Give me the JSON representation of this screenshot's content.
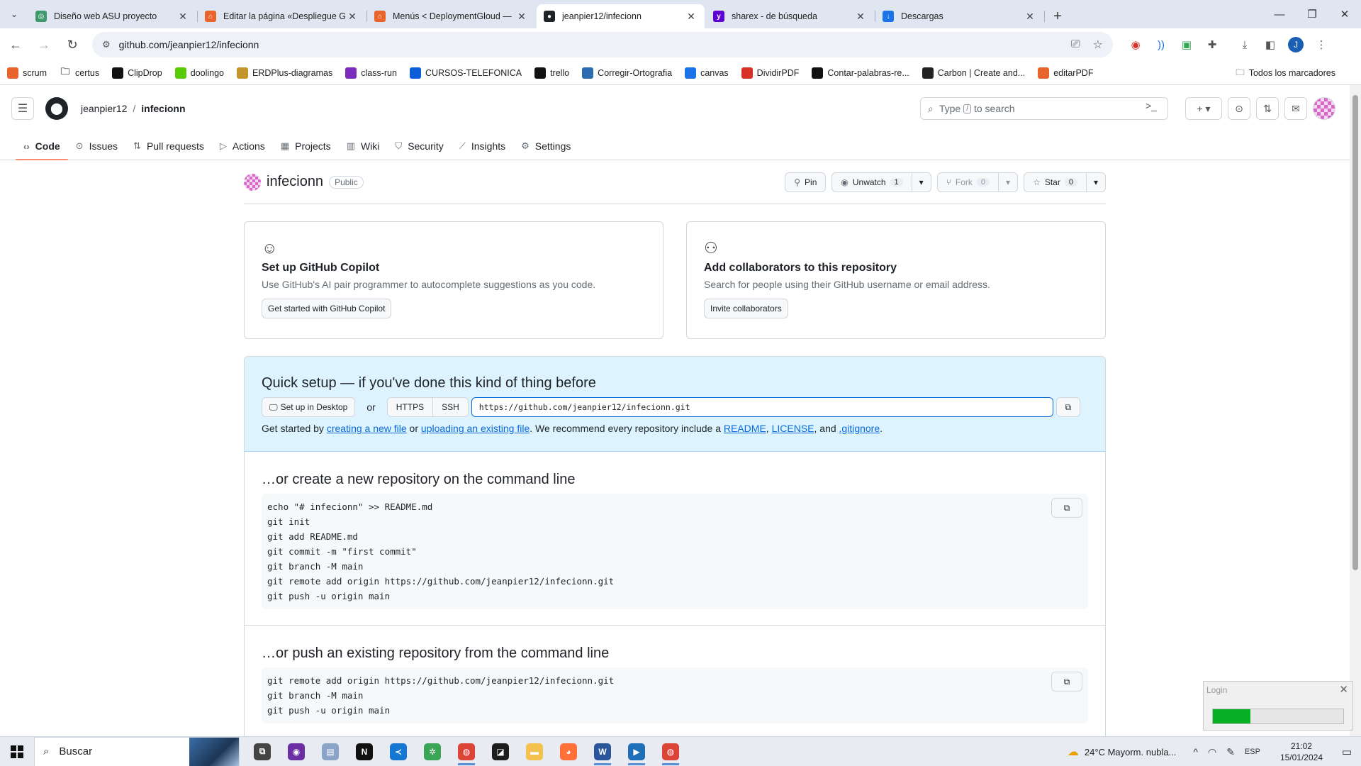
{
  "browser": {
    "tabs": [
      {
        "title": "Diseño web ASU proyecto",
        "color": "#3f9a6b",
        "glyph": "◎"
      },
      {
        "title": "Editar la página «Despliegue Gi",
        "color": "#e8642c",
        "glyph": "⌂"
      },
      {
        "title": "Menús < DeploymentGloud —",
        "color": "#e8642c",
        "glyph": "⌂"
      },
      {
        "title": "jeanpier12/infecionn",
        "color": "#1f2328",
        "glyph": "●",
        "active": true
      },
      {
        "title": "sharex - de búsqueda",
        "color": "#5f01d1",
        "glyph": "y"
      },
      {
        "title": "Descargas",
        "color": "#1a73e8",
        "glyph": "↓"
      }
    ],
    "url": "github.com/jeanpier12/infecionn",
    "profile_initial": "J",
    "bookmarks": [
      {
        "label": "scrum",
        "color": "#e8642c"
      },
      {
        "label": "certus",
        "color": "#555555",
        "folder": true
      },
      {
        "label": "ClipDrop",
        "color": "#111111"
      },
      {
        "label": "doolingo",
        "color": "#58cc02"
      },
      {
        "label": "ERDPlus-diagramas",
        "color": "#c4952c"
      },
      {
        "label": "class-run",
        "color": "#7b2cbf"
      },
      {
        "label": "CURSOS-TELEFONICA",
        "color": "#0b5ed7"
      },
      {
        "label": "trello",
        "color": "#111111"
      },
      {
        "label": "Corregir-Ortografia",
        "color": "#2b6cb0"
      },
      {
        "label": "canvas",
        "color": "#1a73e8"
      },
      {
        "label": "DividirPDF",
        "color": "#d93025"
      },
      {
        "label": "Contar-palabras-re...",
        "color": "#111111"
      },
      {
        "label": "Carbon | Create and...",
        "color": "#222222"
      },
      {
        "label": "editarPDF",
        "color": "#e8642c"
      }
    ],
    "all_bookmarks": "Todos los marcadores"
  },
  "github": {
    "owner": "jeanpier12",
    "repo": "infecionn",
    "search_prefix": "Type",
    "search_key": "/",
    "search_suffix": "to search",
    "nav": [
      {
        "label": "Code",
        "icon": "‹›",
        "active": true
      },
      {
        "label": "Issues",
        "icon": "⊙"
      },
      {
        "label": "Pull requests",
        "icon": "⇅"
      },
      {
        "label": "Actions",
        "icon": "▷"
      },
      {
        "label": "Projects",
        "icon": "▦"
      },
      {
        "label": "Wiki",
        "icon": "▥"
      },
      {
        "label": "Security",
        "icon": "⛉"
      },
      {
        "label": "Insights",
        "icon": "⟋"
      },
      {
        "label": "Settings",
        "icon": "⚙"
      }
    ],
    "visibility": "Public",
    "pin_label": "Pin",
    "unwatch_label": "Unwatch",
    "watch_count": "1",
    "fork_label": "Fork",
    "fork_count": "0",
    "star_label": "Star",
    "star_count": "0",
    "copilot": {
      "title": "Set up GitHub Copilot",
      "desc": "Use GitHub's AI pair programmer to autocomplete suggestions as you code.",
      "button": "Get started with GitHub Copilot"
    },
    "collab": {
      "title": "Add collaborators to this repository",
      "desc": "Search for people using their GitHub username or email address.",
      "button": "Invite collaborators"
    },
    "quick_setup": {
      "title": "Quick setup — if you've done this kind of thing before",
      "desktop_button": "Set up in Desktop",
      "or": "or",
      "https": "HTTPS",
      "ssh": "SSH",
      "clone_url": "https://github.com/jeanpier12/infecionn.git",
      "hint_1": "Get started by ",
      "link_new_file": "creating a new file",
      "hint_2": " or ",
      "link_upload": "uploading an existing file",
      "hint_3": ". We recommend every repository include a ",
      "link_readme": "README",
      "hint_4": ", ",
      "link_license": "LICENSE",
      "hint_5": ", and ",
      "link_gitignore": ".gitignore",
      "hint_6": "."
    },
    "create_section": {
      "title": "…or create a new repository on the command line",
      "lines": [
        "echo \"# infecionn\" >> README.md",
        "git init",
        "git add README.md",
        "git commit -m \"first commit\"",
        "git branch -M main",
        "git remote add origin https://github.com/jeanpier12/infecionn.git",
        "git push -u origin main"
      ]
    },
    "push_section": {
      "title": "…or push an existing repository from the command line",
      "lines": [
        "git remote add origin https://github.com/jeanpier12/infecionn.git",
        "git branch -M main",
        "git push -u origin main"
      ]
    }
  },
  "login_popup": {
    "title": "Login",
    "progress": 0.29
  },
  "taskbar": {
    "search_label": "Buscar",
    "apps": [
      {
        "name": "task-view",
        "color": "#444444",
        "glyph": "⧉"
      },
      {
        "name": "app-purple",
        "color": "#6b2fa3",
        "glyph": "◉"
      },
      {
        "name": "app-files",
        "color": "#8aa4c8",
        "glyph": "▤"
      },
      {
        "name": "notion",
        "color": "#111111",
        "glyph": "N"
      },
      {
        "name": "vscode",
        "color": "#1677d2",
        "glyph": "≺"
      },
      {
        "name": "app-green",
        "color": "#3aa655",
        "glyph": "✲"
      },
      {
        "name": "chrome",
        "color": "#db4437",
        "glyph": "◍",
        "open": true
      },
      {
        "name": "app-black",
        "color": "#1d1d1d",
        "glyph": "◪"
      },
      {
        "name": "explorer",
        "color": "#f2c14e",
        "glyph": "▬"
      },
      {
        "name": "firefox",
        "color": "#ff7139",
        "glyph": "◕"
      },
      {
        "name": "word",
        "color": "#2b579a",
        "glyph": "W",
        "open": true
      },
      {
        "name": "app-blue",
        "color": "#1e6fb8",
        "glyph": "▶",
        "open": true
      },
      {
        "name": "chrome-2",
        "color": "#db4437",
        "glyph": "◍",
        "open": true
      }
    ],
    "weather": "24°C  Mayorm. nubla...",
    "lang": "ESP",
    "time": "21:02",
    "date": "15/01/2024"
  }
}
